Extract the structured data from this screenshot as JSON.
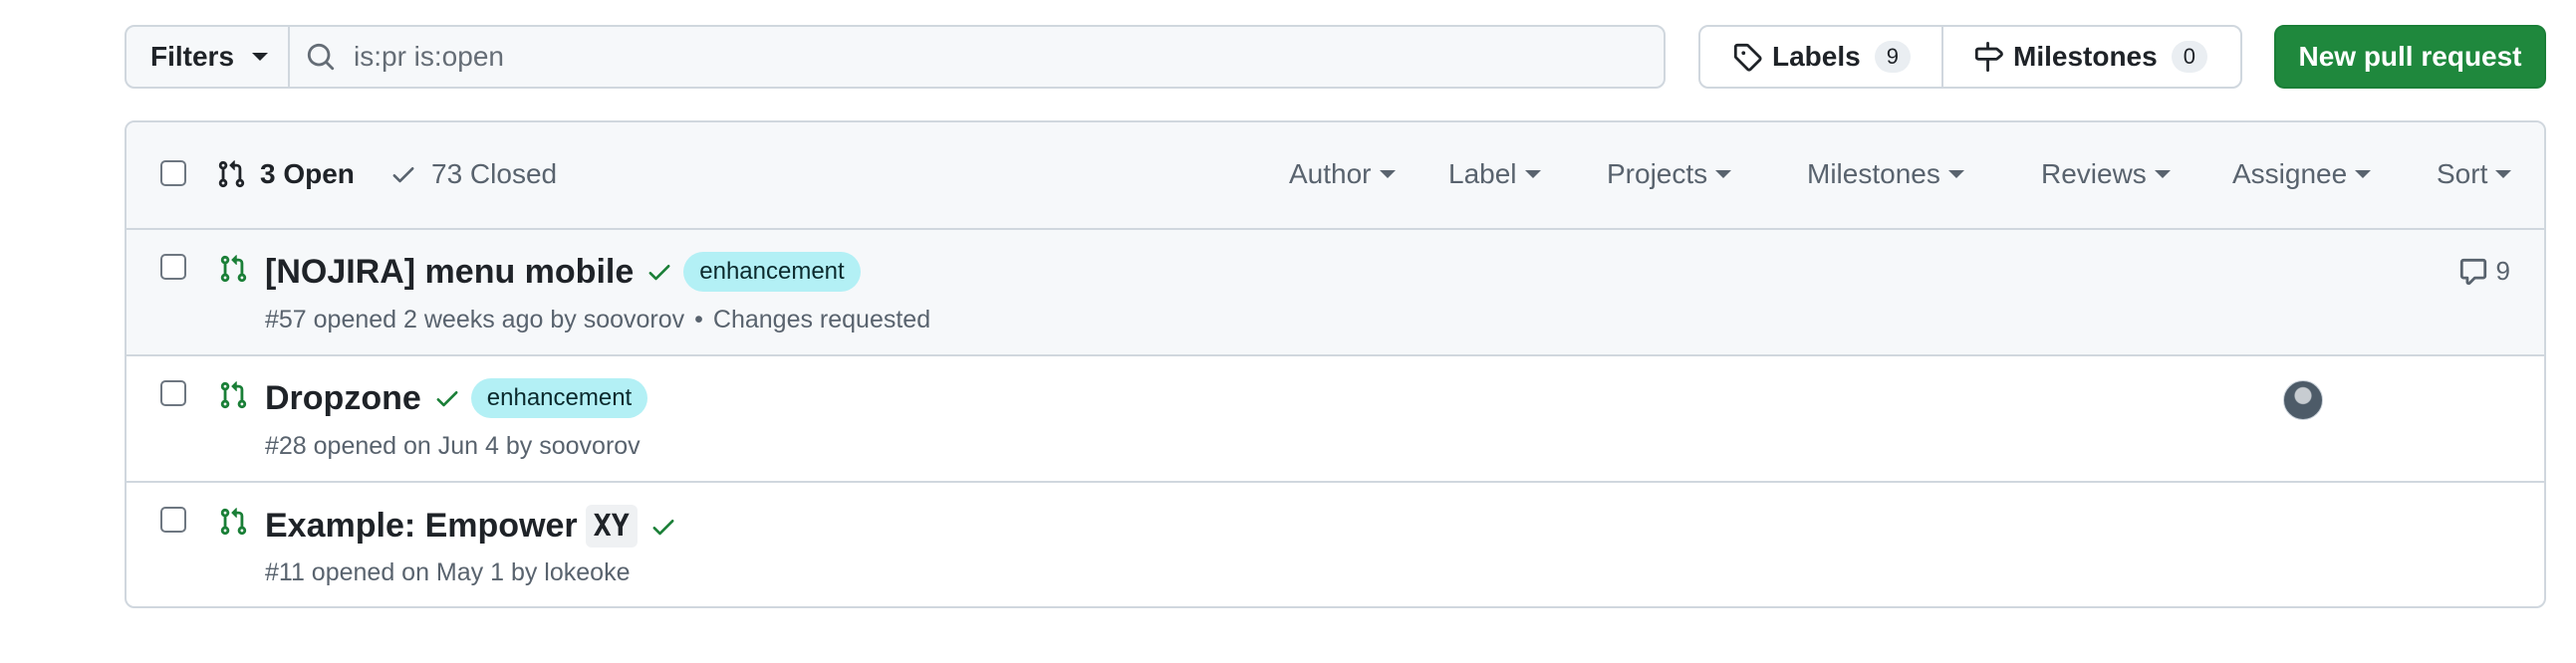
{
  "toolbar": {
    "filters_label": "Filters",
    "search_value": "is:pr is:open",
    "labels_label": "Labels",
    "labels_count": "9",
    "milestones_label": "Milestones",
    "milestones_count": "0",
    "new_pr_label": "New pull request"
  },
  "header": {
    "open_label": "3 Open",
    "closed_label": "73 Closed",
    "filters": [
      "Author",
      "Label",
      "Projects",
      "Milestones",
      "Reviews",
      "Assignee",
      "Sort"
    ]
  },
  "pull_requests": [
    {
      "title": "[NOJIRA] menu mobile",
      "label": "enhancement",
      "meta": "#57 opened 2 weeks ago by soovorov",
      "review": "Changes requested",
      "comments": "9"
    },
    {
      "title": "Dropzone",
      "label": "enhancement",
      "meta": "#28 opened on Jun 4 by soovorov"
    },
    {
      "title": "Example: Empower",
      "code": "XY",
      "meta": "#11 opened on May 1 by lokeoke"
    }
  ],
  "colors": {
    "accent_green": "#1f883d",
    "open_icon_green": "#1a7f37",
    "label_bg": "#b3f0f5",
    "border": "#d0d7de",
    "header_bg": "#f6f8fa"
  },
  "icons": {
    "search": "search-icon",
    "tag": "tag-icon",
    "milestone": "milestone-icon",
    "pr_open": "git-pull-request-icon",
    "check": "check-icon",
    "comment": "comment-icon"
  }
}
